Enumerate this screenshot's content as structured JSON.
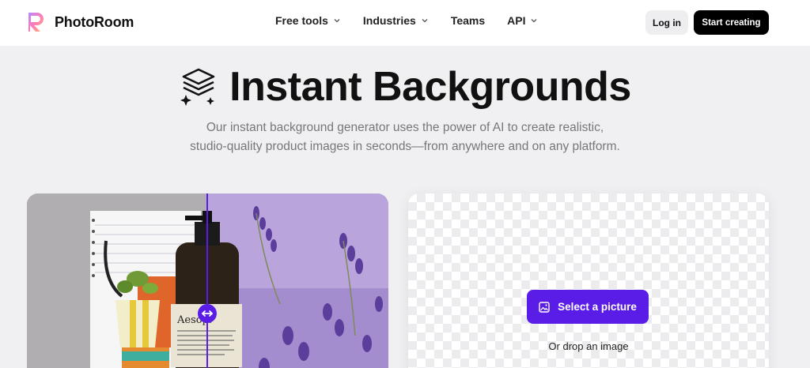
{
  "header": {
    "brand": "PhotoRoom",
    "nav": [
      {
        "label": "Free tools",
        "has_dropdown": true
      },
      {
        "label": "Industries",
        "has_dropdown": true
      },
      {
        "label": "Teams",
        "has_dropdown": false
      },
      {
        "label": "API",
        "has_dropdown": true
      }
    ],
    "login_label": "Log in",
    "start_label": "Start creating"
  },
  "hero": {
    "title": "Instant Backgrounds",
    "subtitle_line1": "Our instant background generator uses the power of AI to create realistic,",
    "subtitle_line2": "studio-quality product images in seconds—from anywhere and on any platform."
  },
  "demo": {
    "bottle_label": "Aesop."
  },
  "upload": {
    "select_label": "Select a picture",
    "drop_label": "Or drop an image"
  },
  "colors": {
    "accent": "#5a1de8",
    "page_bg": "#f0f0f3",
    "header_bg": "#ffffff"
  },
  "icons": [
    "photoroom-logo-icon",
    "layers-sparkle-icon",
    "chevron-down-icon",
    "swap-arrows-icon",
    "image-icon"
  ]
}
